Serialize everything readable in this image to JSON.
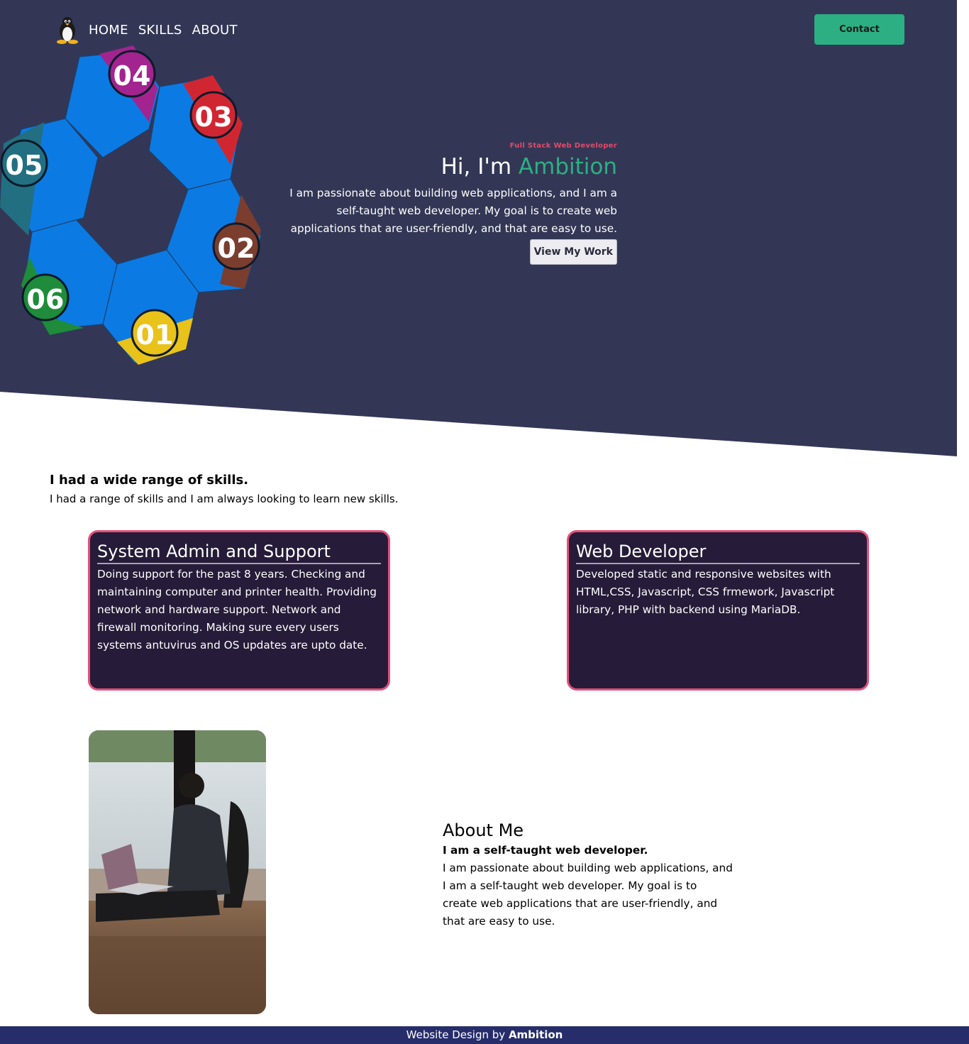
{
  "colors": {
    "hero_bg": "#333755",
    "accent_green": "#2cb083",
    "accent_pink": "#e24a69",
    "card_bg": "#261b38",
    "card_border": "#e3507a",
    "footer_bg": "#262d6a"
  },
  "nav": {
    "logo": "linux-penguin-icon",
    "links": [
      "HOME",
      "SKILLS",
      "ABOUT"
    ],
    "contact_label": "Contact"
  },
  "hero": {
    "eyebrow": "Full Stack Web Developer",
    "title_prefix": "Hi, I'm ",
    "title_name": "Ambition",
    "description": "I am passionate about building web applications, and I am a self-taught web developer. My goal is to create web applications that are user-friendly, and that are easy to use.",
    "button_label": "View My Work",
    "graphic_numbers": [
      "01",
      "02",
      "03",
      "04",
      "05",
      "06"
    ]
  },
  "skills": {
    "heading": "I had a wide range of skills.",
    "subheading": "I had a range of skills and I am always looking to learn new skills.",
    "cards": [
      {
        "title": "System Admin and Support",
        "text": "Doing support for the past 8 years. Checking and maintaining computer and printer health. Providing network and hardware support. Network and firewall monitoring. Making sure every users systems antuvirus and OS updates are upto date."
      },
      {
        "title": "Web Developer",
        "text": "Developed static and responsive websites with HTML,CSS, Javascript, CSS frmework, Javascript library, PHP with backend using MariaDB."
      }
    ]
  },
  "about": {
    "title": "About Me",
    "lead": "I am a self-taught web developer.",
    "description": "I am passionate about building web applications, and I am a self-taught web developer. My goal is to create web applications that are user-friendly, and that are easy to use."
  },
  "footer": {
    "prefix": "Website Design by ",
    "name": "Ambition"
  }
}
